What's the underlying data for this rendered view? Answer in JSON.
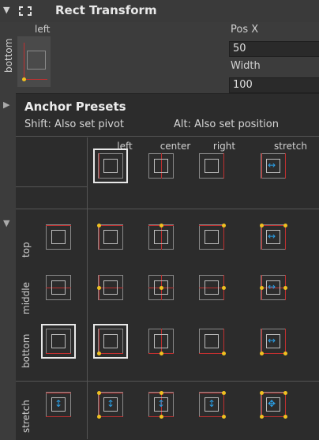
{
  "header": {
    "title": "Rect Transform",
    "mini_top_label": "left",
    "mini_side_label": "bottom"
  },
  "fields": {
    "pos_x_label": "Pos X",
    "pos_x_value": "50",
    "width_label": "Width",
    "width_value": "100"
  },
  "panel": {
    "title": "Anchor Presets",
    "shift_hint": "Shift: Also set pivot",
    "alt_hint": "Alt: Also set position"
  },
  "columns": [
    "left",
    "center",
    "right",
    "stretch"
  ],
  "rows": [
    "top",
    "middle",
    "bottom",
    "stretch"
  ],
  "colors": {
    "anchor_line": "#c03030",
    "anchor_dot": "#f0c020",
    "stretch_arrow": "#2aa0e8"
  }
}
